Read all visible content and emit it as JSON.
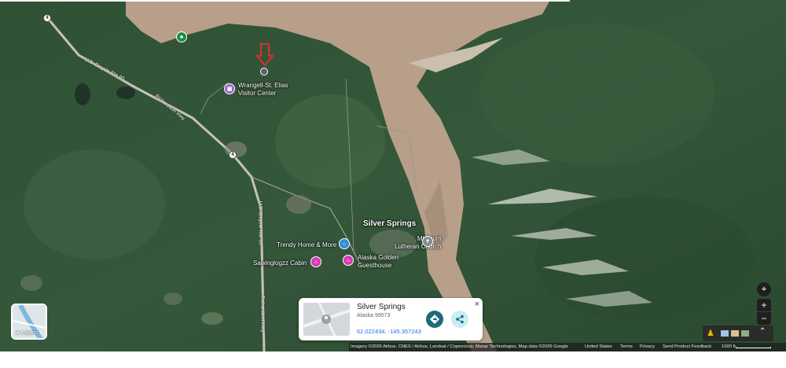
{
  "map": {
    "town_label": "Silver Springs",
    "places": [
      {
        "id": "visitor",
        "label_line1": "Wrangell-St. Elias",
        "label_line2": "Visitor Center",
        "color": "#a05fd0"
      },
      {
        "id": "trendy",
        "label_line1": "Trendy Home & More",
        "label_line2": "",
        "color": "#2e8ed8"
      },
      {
        "id": "lutheran",
        "label_line1": "Mt Drum",
        "label_line2": "Lutheran Church",
        "color": "#7f8c8d"
      },
      {
        "id": "cabin",
        "label_line1": "Sawinglogzz Cabin",
        "label_line2": "",
        "color": "#d63ab5"
      },
      {
        "id": "guesthouse",
        "label_line1": "Alaska Golden",
        "label_line2": "Guesthouse",
        "color": "#d63ab5"
      }
    ],
    "roads": {
      "bicycle_1": "U.S. Bicycle Rte 95",
      "richardson_1": "Richardson Hwy",
      "bicycle_2": "U.S. Bicycle Rte 95",
      "richardson_2": "Richardson Hwy",
      "shield": "4"
    },
    "selected_marker_icon": "red-arrow-down-icon"
  },
  "layers": {
    "label": "Layers"
  },
  "place_card": {
    "title": "Silver Springs",
    "subtitle": "Alaska 99573",
    "coordinates": "62.022434, -145.357243",
    "close": "×",
    "directions_color": "#1e6b79",
    "share_color": "#c6eef4"
  },
  "controls": {
    "zoom_in": "+",
    "zoom_out": "−"
  },
  "footer": {
    "attribution": "Imagery ©2026 Airbus, CNES / Airbus, Landsat / Copernicus, Maxar Technologies, Map data ©2026 Google",
    "united_states": "United States",
    "terms": "Terms",
    "privacy": "Privacy",
    "feedback": "Send Product Feedback",
    "scale": "1000 ft"
  }
}
